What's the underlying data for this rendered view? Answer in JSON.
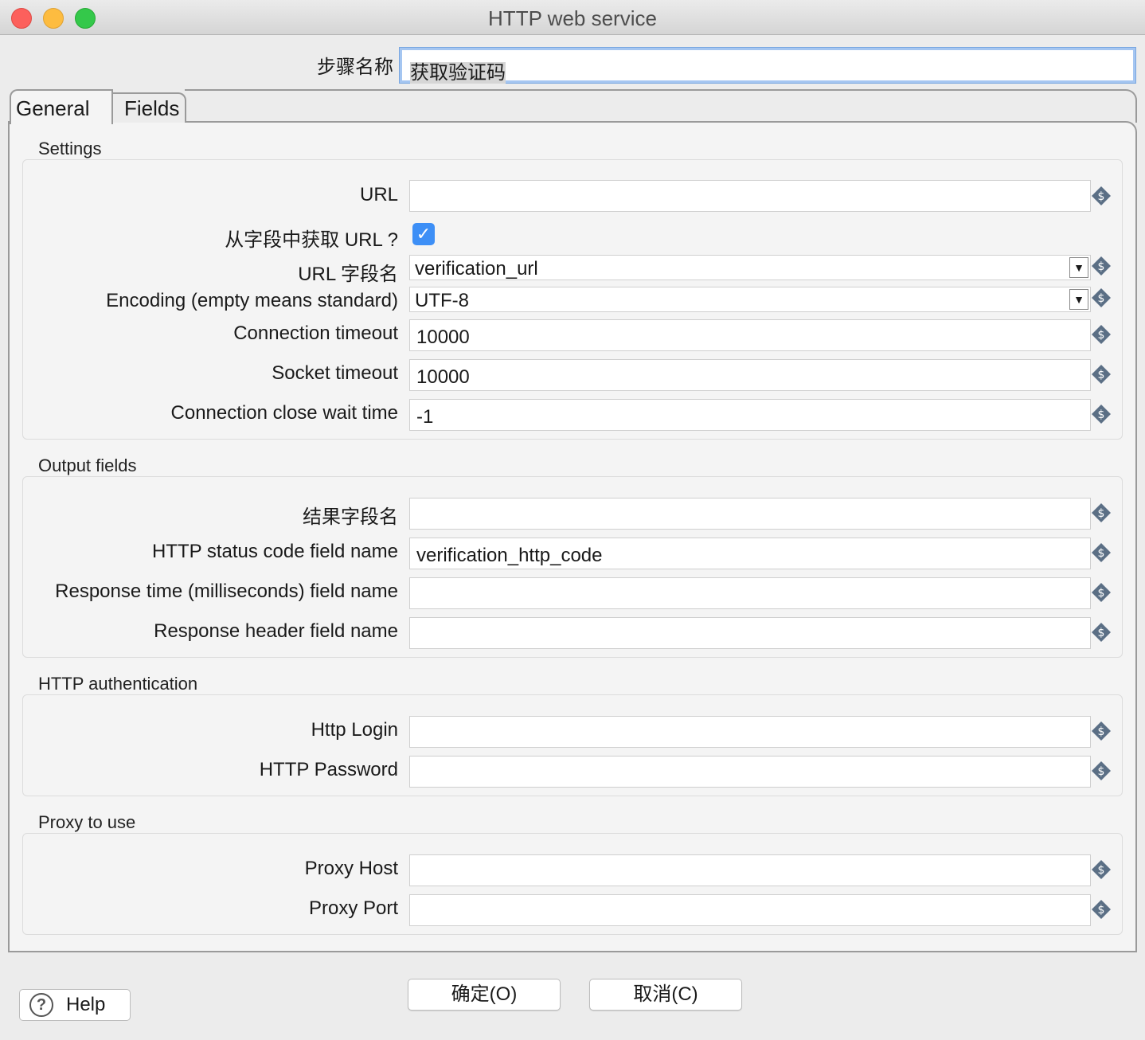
{
  "window": {
    "title": "HTTP web service"
  },
  "step": {
    "label": "步骤名称",
    "value": "获取验证码"
  },
  "tabs": [
    {
      "label": "General"
    },
    {
      "label": "Fields"
    }
  ],
  "groups": {
    "settings": {
      "title": "Settings",
      "url_label": "URL",
      "url_value": "",
      "url_from_field_label": "从字段中获取 URL ?",
      "url_from_field_checked": true,
      "url_field_label": "URL 字段名",
      "url_field_value": "verification_url",
      "encoding_label": "Encoding (empty means standard)",
      "encoding_value": "UTF-8",
      "conn_timeout_label": "Connection timeout",
      "conn_timeout_value": "10000",
      "socket_timeout_label": "Socket timeout",
      "socket_timeout_value": "10000",
      "close_wait_label": "Connection close wait time",
      "close_wait_value": "-1"
    },
    "output": {
      "title": "Output fields",
      "result_label": "结果字段名",
      "result_value": "",
      "status_label": "HTTP status code field name",
      "status_value": "verification_http_code",
      "resp_time_label": "Response time (milliseconds) field name",
      "resp_time_value": "",
      "resp_header_label": "Response header field name",
      "resp_header_value": ""
    },
    "auth": {
      "title": "HTTP authentication",
      "login_label": "Http Login",
      "login_value": "",
      "password_label": "HTTP Password",
      "password_value": ""
    },
    "proxy": {
      "title": "Proxy to use",
      "host_label": "Proxy Host",
      "host_value": "",
      "port_label": "Proxy Port",
      "port_value": ""
    }
  },
  "buttons": {
    "help": "Help",
    "ok": "确定(O)",
    "cancel": "取消(C)"
  },
  "icons": {
    "variable": "variable-dollar-diamond-icon",
    "help": "question-circle-icon",
    "check": "checkmark-icon"
  },
  "colors": {
    "checkbox": "#3d8ff6",
    "focus_ring": "#a5c6f1"
  }
}
